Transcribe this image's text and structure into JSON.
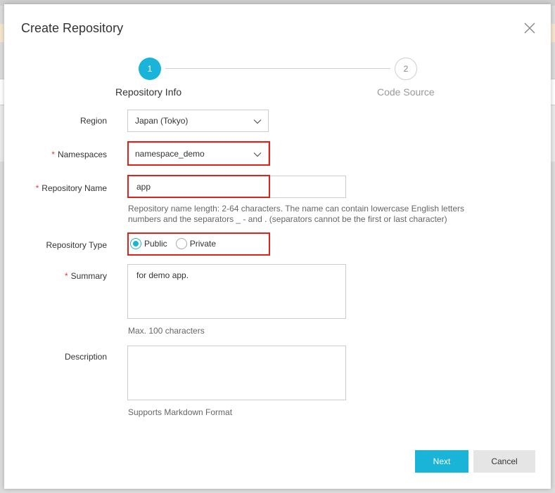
{
  "dialog": {
    "title": "Create Repository"
  },
  "steps": [
    {
      "number": "1",
      "label": "Repository Info",
      "active": true
    },
    {
      "number": "2",
      "label": "Code Source",
      "active": false
    }
  ],
  "form": {
    "region": {
      "label": "Region",
      "value": "Japan (Tokyo)"
    },
    "namespaces": {
      "label": "Namespaces",
      "required_mark": "*",
      "value": "namespace_demo"
    },
    "repository_name": {
      "label": "Repository Name",
      "required_mark": "*",
      "value": "app",
      "help_line1": "Repository name length: 2-64 characters. The name can contain lowercase English letters",
      "help_line2": "numbers and the separators _ - and . (separators cannot be the first or last character)"
    },
    "repository_type": {
      "label": "Repository Type",
      "options": [
        {
          "label": "Public",
          "checked": true
        },
        {
          "label": "Private",
          "checked": false
        }
      ]
    },
    "summary": {
      "label": "Summary",
      "required_mark": "*",
      "value": "for demo app.",
      "help": "Max. 100 characters"
    },
    "description": {
      "label": "Description",
      "value": "",
      "help": "Supports Markdown Format"
    }
  },
  "buttons": {
    "next": "Next",
    "cancel": "Cancel"
  },
  "colors": {
    "accent": "#19b4d8",
    "highlight": "#e0231a",
    "required": "#e4393c"
  },
  "icons": {
    "close": "close-icon",
    "dropdown": "chevron-down-icon"
  }
}
